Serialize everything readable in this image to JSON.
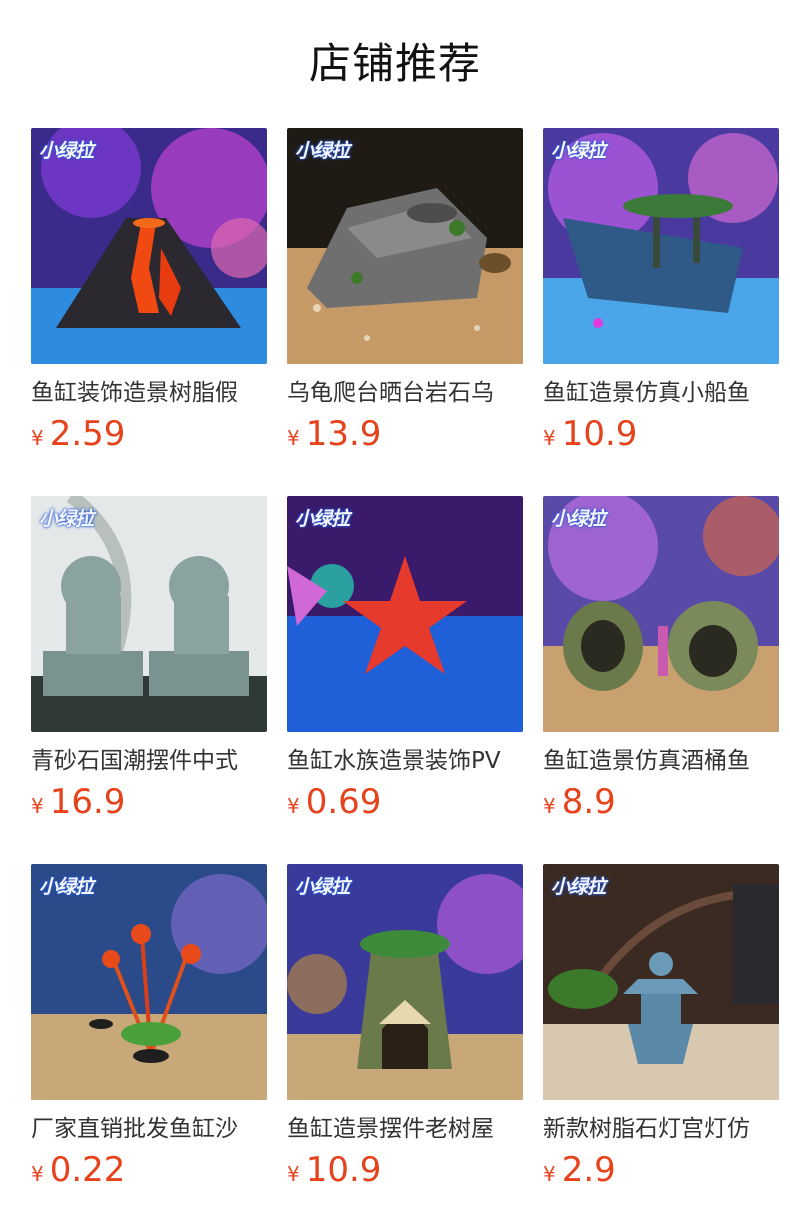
{
  "header": {
    "title": "店铺推荐"
  },
  "brand": {
    "logo_text": "小绿拉"
  },
  "currency_symbol": "¥",
  "products": [
    {
      "name": "鱼缸装饰造景树脂假",
      "price": "2.59",
      "image": "volcano-ornament"
    },
    {
      "name": "乌龟爬台晒台岩石乌",
      "price": "13.9",
      "image": "turtle-rock-platform"
    },
    {
      "name": "鱼缸造景仿真小船鱼",
      "price": "10.9",
      "image": "shipwreck-ornament"
    },
    {
      "name": "青砂石国潮摆件中式",
      "price": "16.9",
      "image": "stone-lion-pair"
    },
    {
      "name": "鱼缸水族造景装饰PV",
      "price": "0.69",
      "image": "red-starfish"
    },
    {
      "name": "鱼缸造景仿真酒桶鱼",
      "price": "8.9",
      "image": "barrel-ornament"
    },
    {
      "name": "厂家直销批发鱼缸沙",
      "price": "0.22",
      "image": "artificial-plant"
    },
    {
      "name": "鱼缸造景摆件老树屋",
      "price": "10.9",
      "image": "tree-house-ornament"
    },
    {
      "name": "新款树脂石灯宫灯仿",
      "price": "2.9",
      "image": "stone-lantern"
    }
  ],
  "colors": {
    "price": "#e6431d",
    "title": "#111111",
    "name": "#333333"
  }
}
